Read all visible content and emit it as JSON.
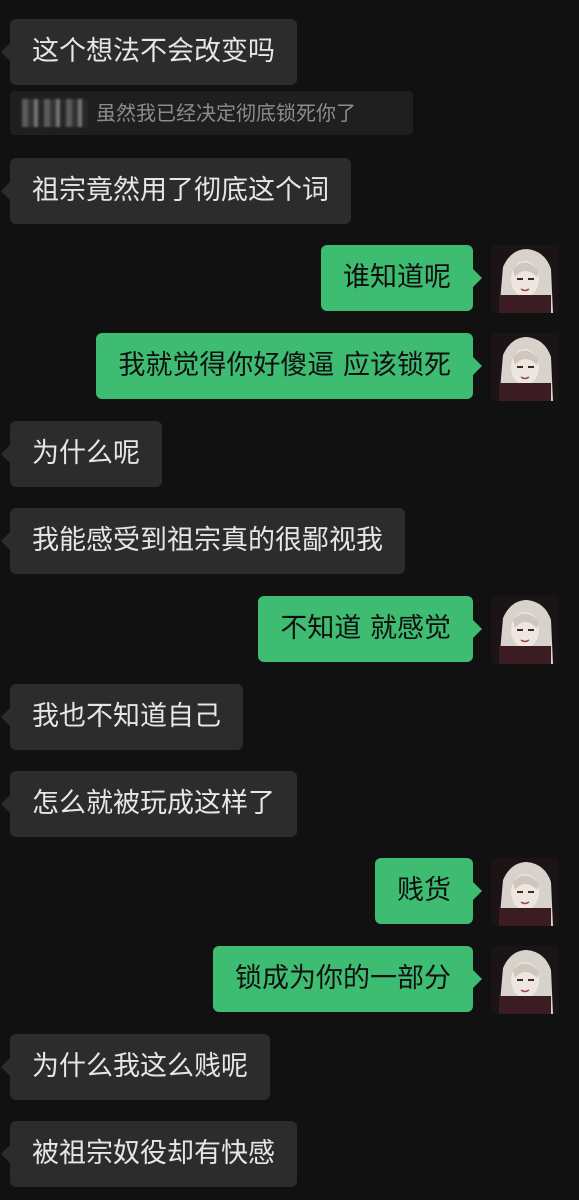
{
  "quote": {
    "author_blurred": "",
    "text": "虽然我已经决定彻底锁死你了"
  },
  "messages": [
    {
      "side": "in",
      "text": "这个想法不会改变吗"
    },
    {
      "side": "in",
      "text": "祖宗竟然用了彻底这个词"
    },
    {
      "side": "out",
      "text": "谁知道呢"
    },
    {
      "side": "out",
      "text": "我就觉得你好傻逼 应该锁死"
    },
    {
      "side": "in",
      "text": "为什么呢"
    },
    {
      "side": "in",
      "text": "我能感受到祖宗真的很鄙视我"
    },
    {
      "side": "out",
      "text": "不知道 就感觉"
    },
    {
      "side": "in",
      "text": "我也不知道自己"
    },
    {
      "side": "in",
      "text": "怎么就被玩成这样了"
    },
    {
      "side": "out",
      "text": "贱货"
    },
    {
      "side": "out",
      "text": "锁成为你的一部分"
    },
    {
      "side": "in",
      "text": "为什么我这么贱呢"
    },
    {
      "side": "in",
      "text": "被祖宗奴役却有快感"
    }
  ],
  "colors": {
    "background": "#111111",
    "incoming_bubble": "#2c2c2c",
    "outgoing_bubble": "#3dbc72",
    "quote_background": "#1f1f1f"
  }
}
